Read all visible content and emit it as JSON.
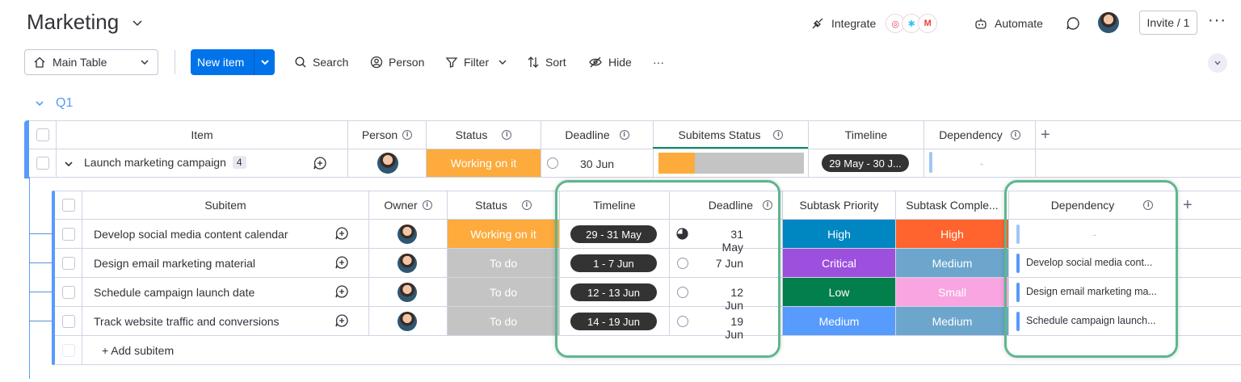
{
  "board": {
    "title": "Marketing"
  },
  "header": {
    "integrate_label": "Integrate",
    "automate_label": "Automate",
    "invite_label": "Invite / 1"
  },
  "toolbar": {
    "view_label": "Main Table",
    "new_item_label": "New item",
    "search_label": "Search",
    "person_label": "Person",
    "filter_label": "Filter",
    "sort_label": "Sort",
    "hide_label": "Hide",
    "more_label": "···"
  },
  "group": {
    "name": "Q1",
    "color": "#579bfc"
  },
  "main_table": {
    "columns": [
      "Item",
      "Person",
      "Status",
      "Deadline",
      "Subitems Status",
      "Timeline",
      "Dependency"
    ],
    "row": {
      "name": "Launch marketing campaign",
      "subitem_count": "4",
      "status": "Working on it",
      "status_color": "#fdab3d",
      "deadline": "30 Jun",
      "subitems_progress": 0.25,
      "timeline": "29 May - 30 J...",
      "dependency": "-"
    }
  },
  "subitems": {
    "columns": [
      "Subitem",
      "Owner",
      "Status",
      "Timeline",
      "Deadline",
      "Subtask Priority",
      "Subtask Comple...",
      "Dependency"
    ],
    "rows": [
      {
        "name": "Develop social media content calendar",
        "status": "Working on it",
        "status_color": "#fdab3d",
        "timeline": "29 - 31 May",
        "deadline": "31 May",
        "priority": "High",
        "priority_color": "#0086c0",
        "complexity": "High",
        "complexity_color": "#ff642e",
        "dependency": "-"
      },
      {
        "name": "Design email marketing material",
        "status": "To do",
        "status_color": "#c4c4c4",
        "timeline": "1 - 7 Jun",
        "deadline": "7 Jun",
        "priority": "Critical",
        "priority_color": "#9d50dd",
        "complexity": "Medium",
        "complexity_color": "#6ca6cc",
        "dependency": "Develop social media cont..."
      },
      {
        "name": "Schedule campaign launch date",
        "status": "To do",
        "status_color": "#c4c4c4",
        "timeline": "12 - 13 Jun",
        "deadline": "12 Jun",
        "priority": "Low",
        "priority_color": "#037f4c",
        "complexity": "Small",
        "complexity_color": "#f8a5e2",
        "dependency": "Design email marketing ma..."
      },
      {
        "name": "Track website traffic and conversions",
        "status": "To do",
        "status_color": "#c4c4c4",
        "timeline": "14 - 19 Jun",
        "deadline": "19 Jun",
        "priority": "Medium",
        "priority_color": "#579bfc",
        "complexity": "Medium",
        "complexity_color": "#6ca6cc",
        "dependency": "Schedule campaign launch..."
      }
    ],
    "add_label": "+ Add subitem"
  },
  "highlight_color": "#5db78d"
}
